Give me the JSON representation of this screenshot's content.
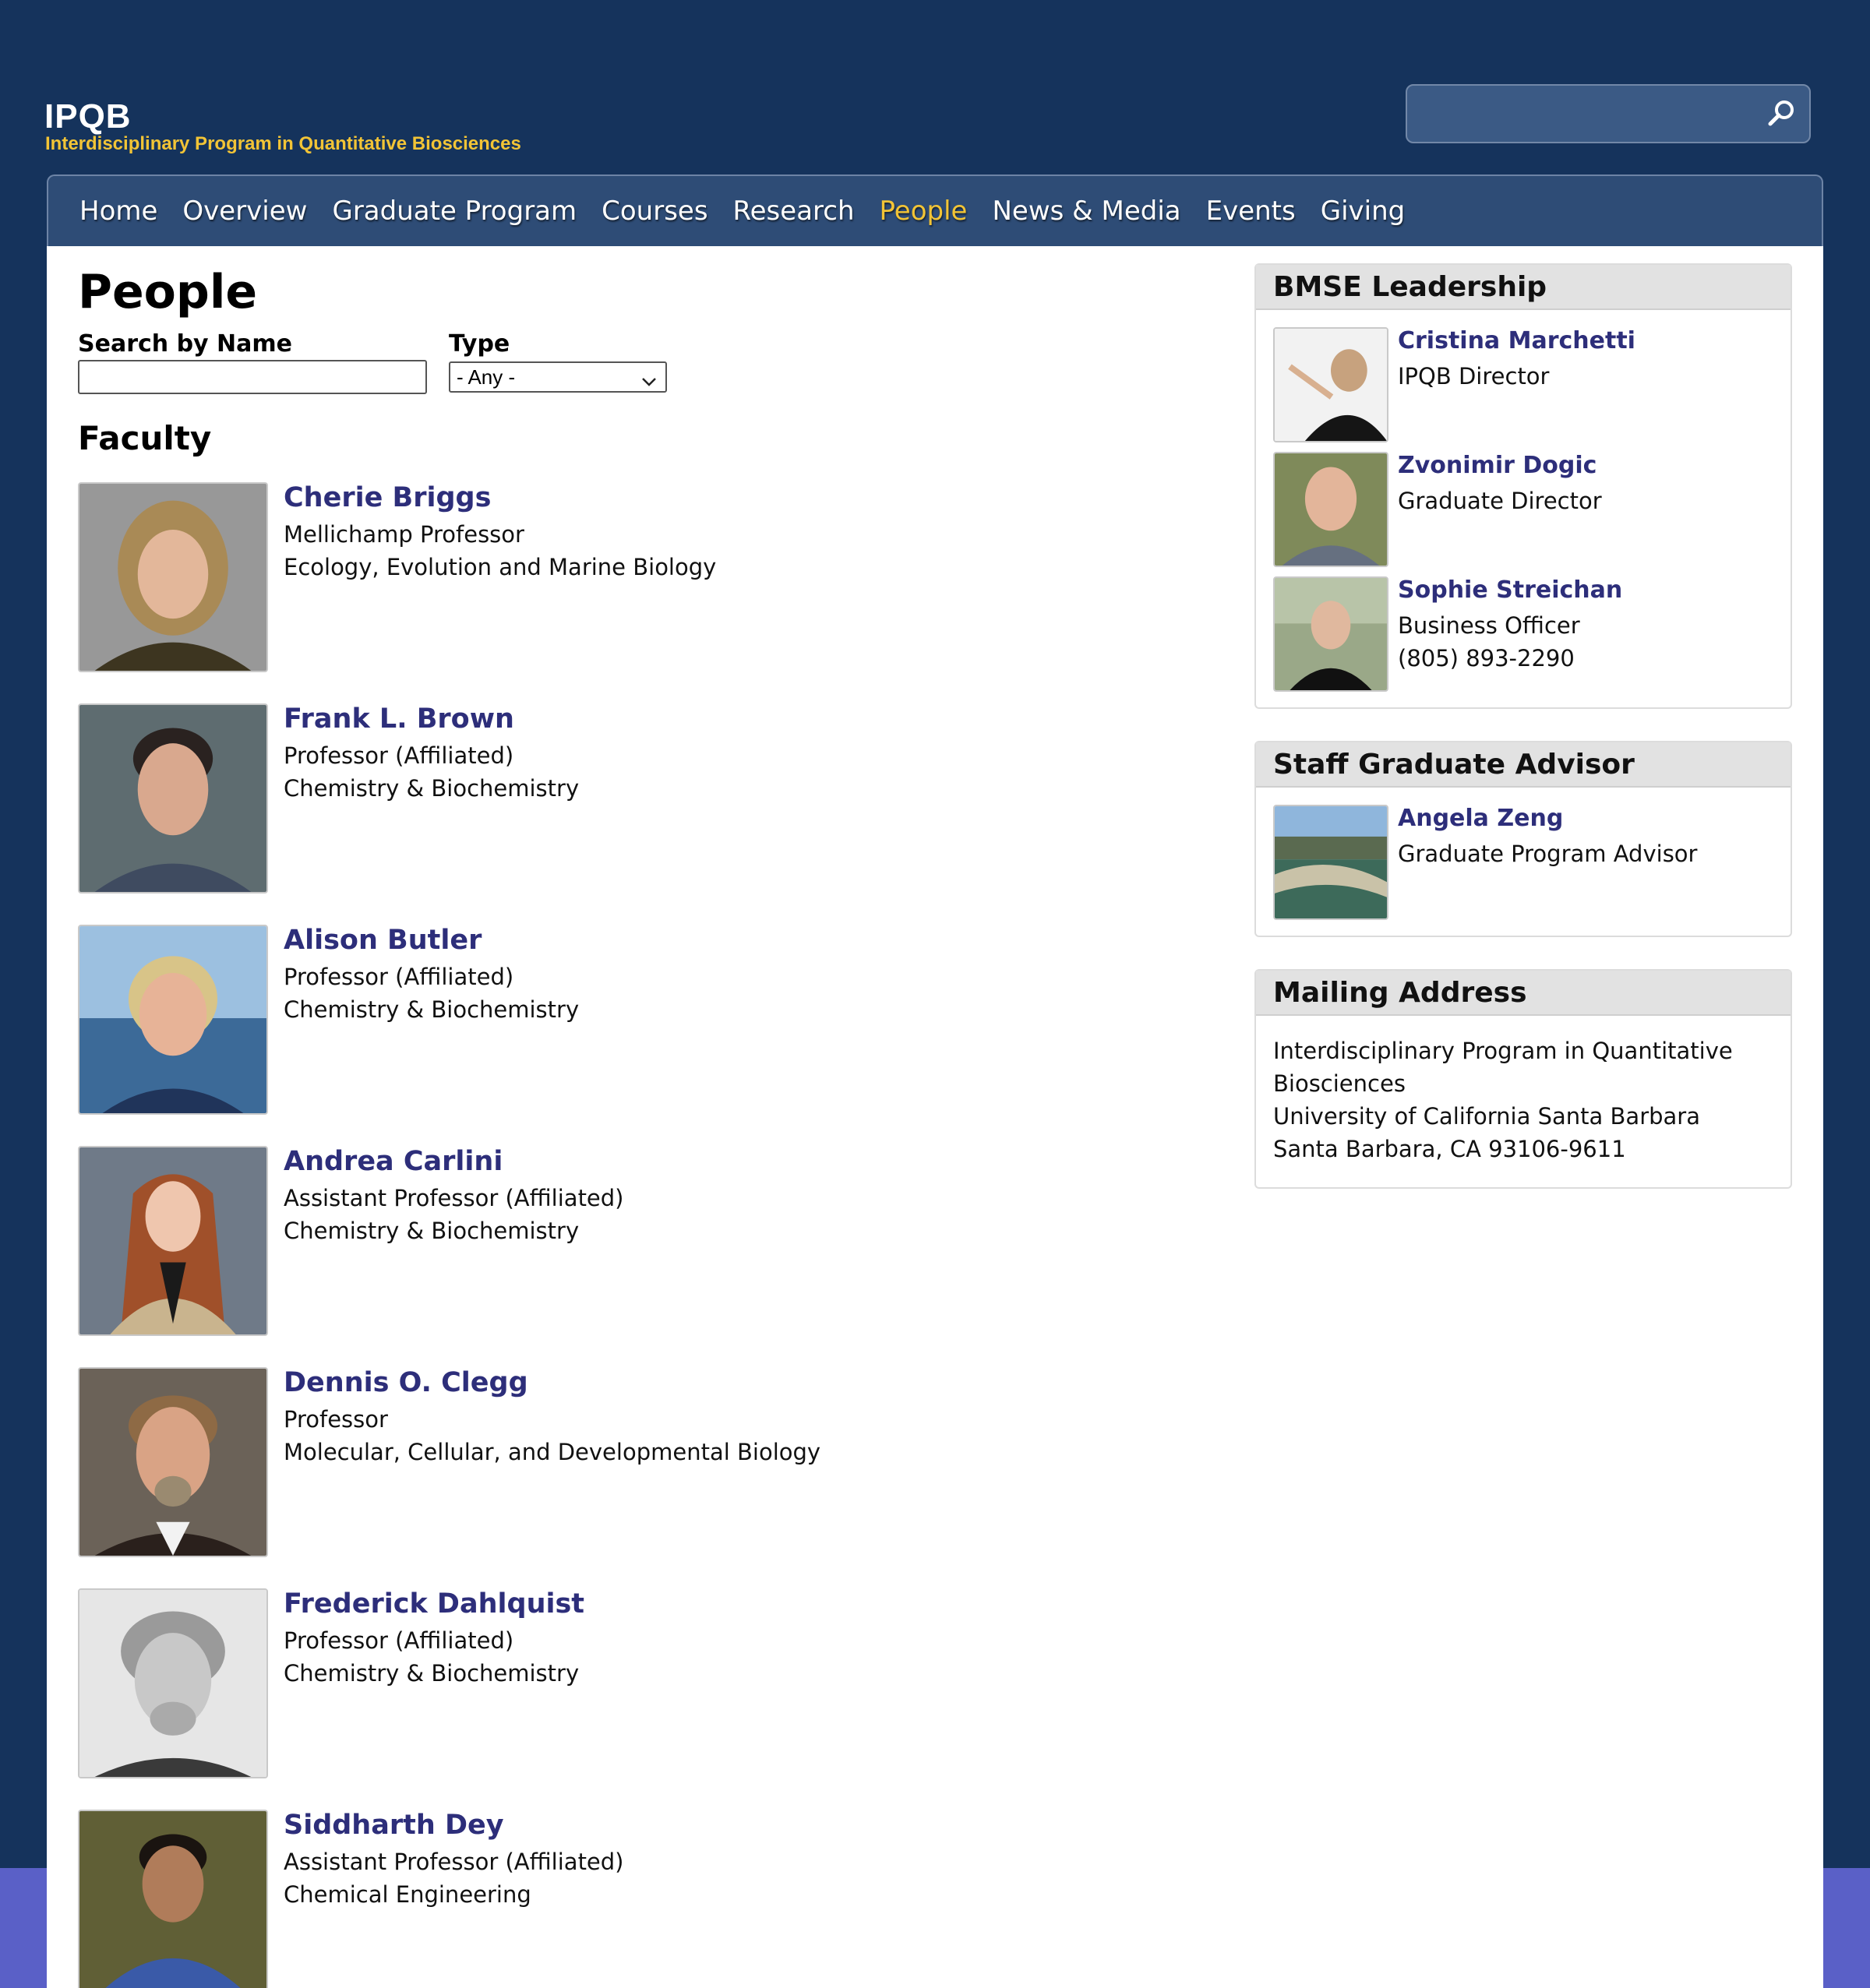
{
  "site": {
    "title": "IPQB",
    "subtitle": "Interdisciplinary Program in Quantitative Biosciences",
    "search_placeholder": ""
  },
  "nav": [
    {
      "label": "Home",
      "active": false
    },
    {
      "label": "Overview",
      "active": false
    },
    {
      "label": "Graduate Program",
      "active": false
    },
    {
      "label": "Courses",
      "active": false
    },
    {
      "label": "Research",
      "active": false
    },
    {
      "label": "People",
      "active": true
    },
    {
      "label": "News & Media",
      "active": false
    },
    {
      "label": "Events",
      "active": false
    },
    {
      "label": "Giving",
      "active": false
    }
  ],
  "page": {
    "title": "People",
    "search_label": "Search by Name",
    "search_value": "",
    "type_label": "Type",
    "type_value": "- Any -",
    "section": "Faculty"
  },
  "faculty": [
    {
      "name": "Cherie Briggs",
      "title": "Mellichamp Professor",
      "department": "Ecology, Evolution and Marine Biology"
    },
    {
      "name": "Frank L. Brown",
      "title": "Professor (Affiliated)",
      "department": "Chemistry & Biochemistry"
    },
    {
      "name": "Alison Butler",
      "title": "Professor (Affiliated)",
      "department": "Chemistry & Biochemistry"
    },
    {
      "name": "Andrea Carlini",
      "title": "Assistant Professor (Affiliated)",
      "department": "Chemistry & Biochemistry"
    },
    {
      "name": "Dennis O. Clegg",
      "title": "Professor",
      "department": "Molecular, Cellular, and Developmental Biology"
    },
    {
      "name": "Frederick Dahlquist",
      "title": "Professor (Affiliated)",
      "department": "Chemistry & Biochemistry"
    },
    {
      "name": "Siddharth Dey",
      "title": "Assistant Professor (Affiliated)",
      "department": "Chemical Engineering"
    }
  ],
  "sidebar": {
    "leadership": {
      "heading": "BMSE Leadership",
      "people": [
        {
          "name": "Cristina Marchetti",
          "role": "IPQB Director",
          "phone": ""
        },
        {
          "name": "Zvonimir Dogic",
          "role": "Graduate Director",
          "phone": ""
        },
        {
          "name": "Sophie Streichan",
          "role": "Business Officer",
          "phone": "(805) 893-2290"
        }
      ]
    },
    "advisor": {
      "heading": "Staff Graduate Advisor",
      "name": "Angela Zeng",
      "role": "Graduate Program Advisor"
    },
    "mailing": {
      "heading": "Mailing Address",
      "lines": [
        "Interdisciplinary Program in Quantitative",
        "Biosciences",
        "University of California Santa Barbara",
        "Santa Barbara, CA 93106-9611"
      ]
    }
  },
  "colors": {
    "page_bg": "#15335c",
    "nav_bg": "#2e4c76",
    "accent": "#f2c436",
    "link": "#2d2e7a",
    "bottom_band": "#5a60c7"
  }
}
